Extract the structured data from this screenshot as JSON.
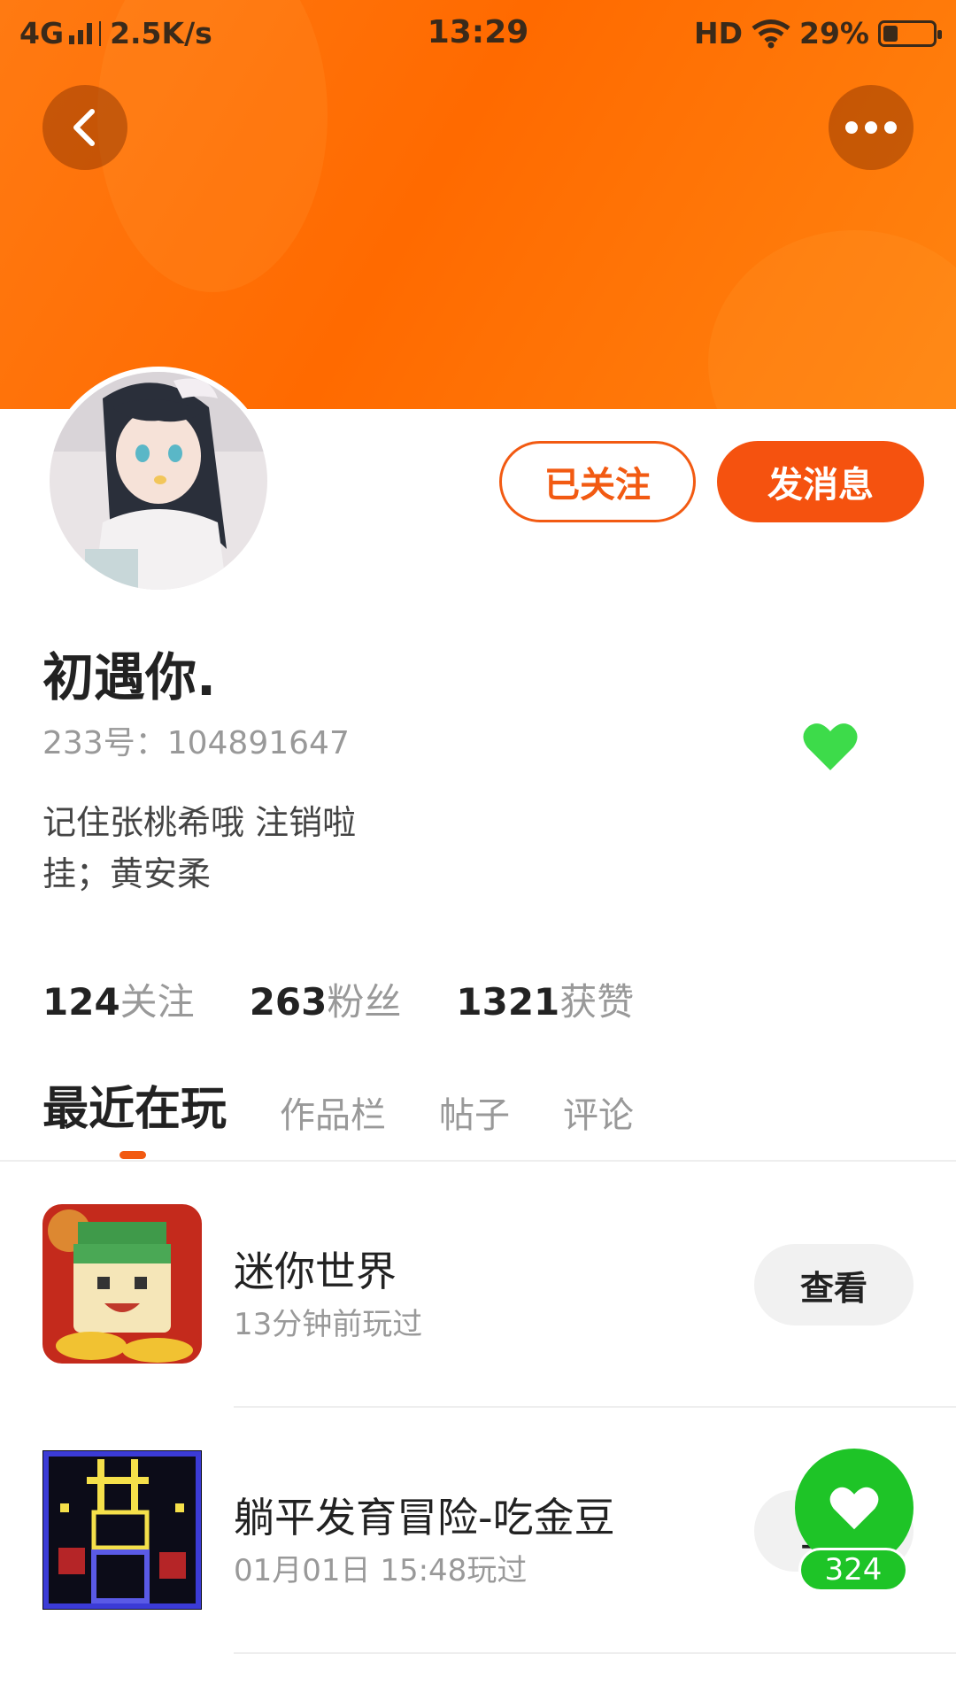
{
  "status_bar": {
    "network": "4G",
    "speed": "2.5K/s",
    "time": "13:29",
    "hd": "HD",
    "battery": "29%",
    "battery_level": 0.29
  },
  "header": {
    "back_icon": "chevron-left-icon",
    "more_icon": "more-horizontal-icon"
  },
  "profile": {
    "followed_label": "已关注",
    "message_label": "发消息",
    "username": "初遇你.",
    "user_id": "233号：104891647",
    "bio_line1": "记住张桃希哦 注销啦",
    "bio_line2": "挂；黄安柔"
  },
  "stats": [
    {
      "num": "124",
      "label": "关注"
    },
    {
      "num": "263",
      "label": "粉丝"
    },
    {
      "num": "1321",
      "label": "获赞"
    }
  ],
  "tabs": [
    "最近在玩",
    "作品栏",
    "帖子",
    "评论"
  ],
  "games": [
    {
      "name": "迷你世界",
      "time": "13分钟前玩过",
      "action": "查看"
    },
    {
      "name": "躺平发育冒险-吃金豆",
      "time": "01月01日 15:48玩过",
      "action": "查看"
    }
  ],
  "like_fab": {
    "count": "324"
  },
  "colors": {
    "accent": "#f25a12",
    "header_orange": "#ff6a00",
    "like_green": "#1ec427",
    "heart_badge_green": "#3ddb4a"
  }
}
